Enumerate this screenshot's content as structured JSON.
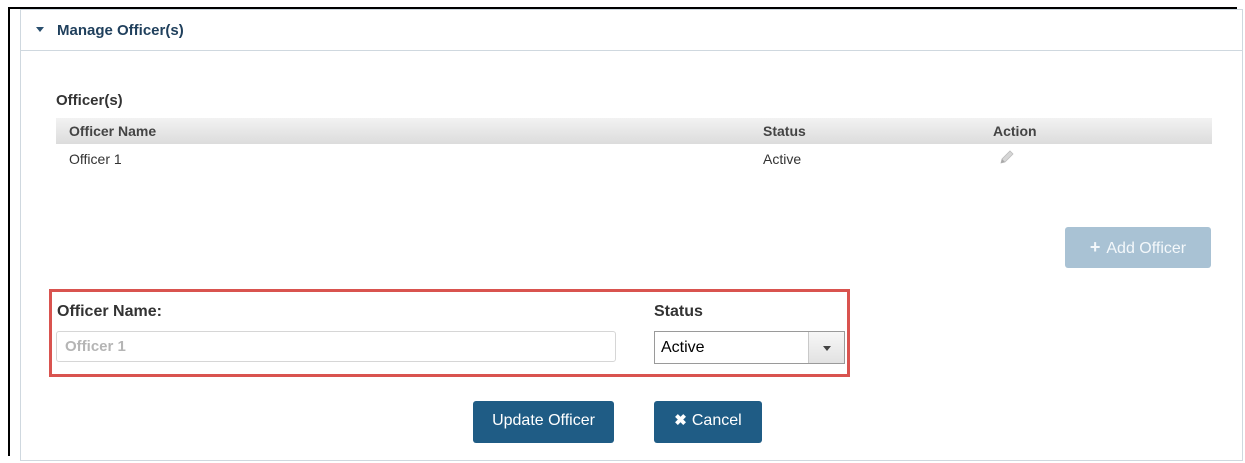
{
  "panel": {
    "title": "Manage Officer(s)"
  },
  "officers": {
    "section_label": "Officer(s)",
    "columns": [
      "Officer Name",
      "Status",
      "Action"
    ],
    "rows": [
      {
        "name": "Officer 1",
        "status": "Active",
        "action_icon": "pencil-icon"
      }
    ],
    "add_button": {
      "icon": "plus-icon",
      "label": "Add Officer",
      "state": "disabled"
    }
  },
  "form": {
    "name_label": "Officer Name:",
    "name_placeholder": "Officer 1",
    "status_label": "Status",
    "status_value": "Active",
    "update_label": "Update Officer",
    "cancel_icon": "x-icon",
    "cancel_label": "Cancel"
  },
  "colors": {
    "primary": "#1f5c85",
    "disabled": "#a9c2d4",
    "highlight": "#d9534f",
    "title": "#1f3f5c"
  }
}
